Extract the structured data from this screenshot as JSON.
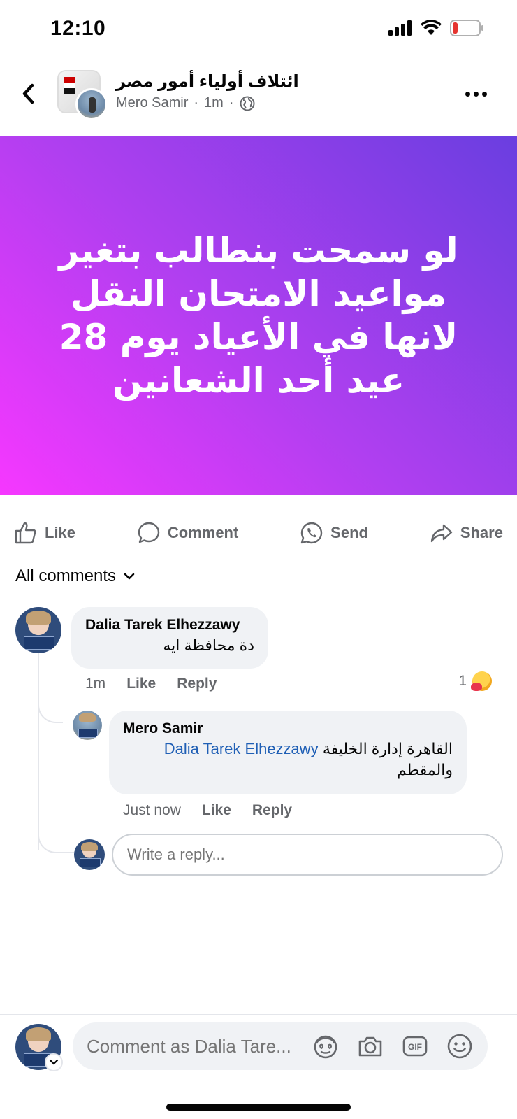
{
  "status_bar": {
    "time": "12:10"
  },
  "header": {
    "group_name": "ائتلاف أولياء أمور مصر",
    "author": "Mero Samir",
    "separator": "·",
    "time_ago": "1m",
    "separator2": "·"
  },
  "post": {
    "text": "لو سمحت بنطالب بتغير مواعيد الامتحان النقل لانها في الأعياد يوم 28 عيد أحد الشعانين",
    "gradient": [
      "#f637ff",
      "#6a3ee0"
    ]
  },
  "actions": {
    "like": "Like",
    "comment": "Comment",
    "send": "Send",
    "share": "Share"
  },
  "comments_filter": "All comments",
  "comments": [
    {
      "author": "Dalia Tarek Elhezzawy",
      "text": "دة محافظة ايه",
      "time": "1m",
      "like": "Like",
      "reply": "Reply",
      "reaction_count": "1"
    }
  ],
  "reply": {
    "author": "Mero Samir",
    "mention": "Dalia Tarek Elhezzawy",
    "text_part1": "القاهرة إدارة الخليفة",
    "text_part2": "والمقطم",
    "time": "Just now",
    "like": "Like",
    "reply": "Reply"
  },
  "reply_input": {
    "placeholder": "Write a reply..."
  },
  "composer": {
    "placeholder": "Comment as Dalia Tare..."
  },
  "icons": [
    "back-icon",
    "more-icon",
    "globe-icon",
    "like-icon",
    "comment-icon",
    "whatsapp-icon",
    "share-icon",
    "chevron-down-icon",
    "avatar-sticker-icon",
    "camera-icon",
    "gif-icon",
    "emoji-icon"
  ]
}
